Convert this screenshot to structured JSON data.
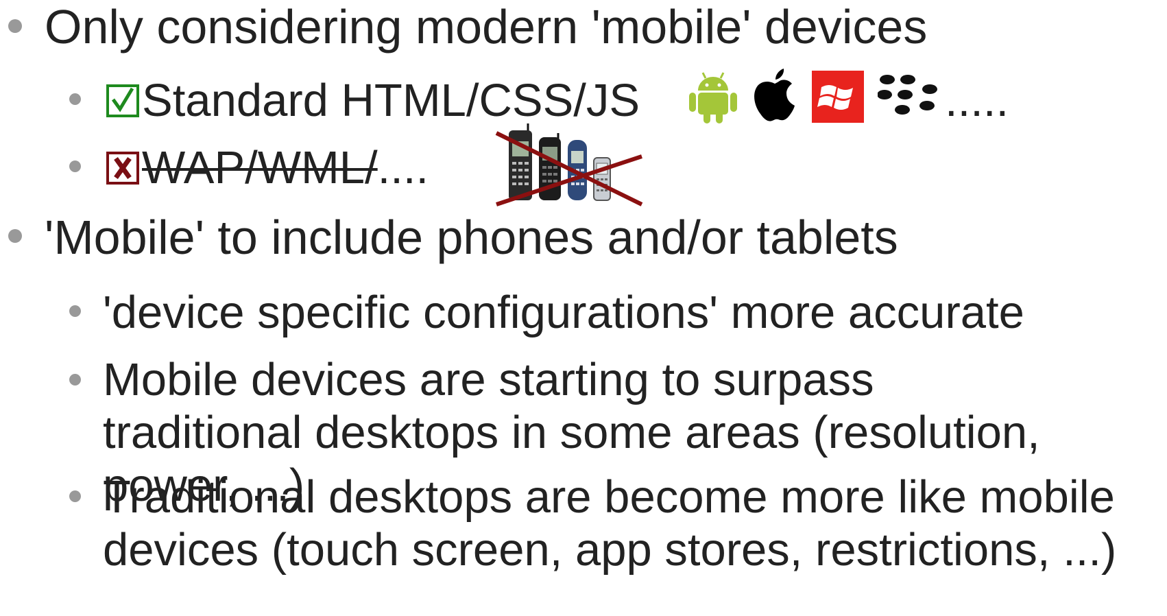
{
  "slide": {
    "bullet_1": "Only considering modern 'mobile' devices",
    "sub_standard": "Standard HTML/CSS/JS",
    "platform_trailing": ".....",
    "sub_wap_struck": "WAP/WML/",
    "sub_wap_trailing": "....",
    "bullet_2": "'Mobile' to include phones and/or tablets",
    "sub_config": "'device specific configurations' more accurate",
    "sub_surpass": "Mobile devices are starting to surpass traditional desktops in some areas (resolution, power, ...)",
    "sub_traditional": "Traditional desktops are become more like mobile devices (touch screen, app stores, restrictions, ...)"
  },
  "icons": [
    "check-icon",
    "cross-icon",
    "android-icon",
    "apple-icon",
    "windows-icon",
    "blackberry-icon",
    "old-phones-image"
  ],
  "colors": {
    "text": "#222222",
    "bullet": "#999999",
    "check": "#1e8a1e",
    "cross": "#7a0f14",
    "android": "#a4c639",
    "windows": "#e8231e",
    "phones_strike": "#8b1010"
  }
}
